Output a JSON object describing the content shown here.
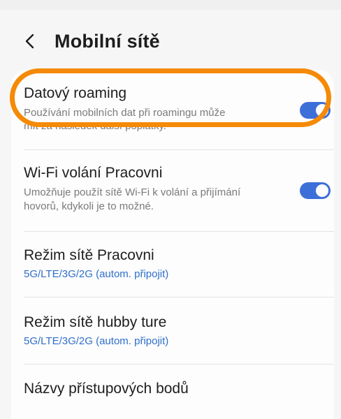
{
  "header": {
    "title": "Mobilní sítě"
  },
  "items": [
    {
      "title": "Datový roaming",
      "description_line1": "Používání mobilních dat při roamingu může",
      "description_line2": "mít za následek další poplatky.",
      "toggle_on": true
    },
    {
      "title": "Wi-Fi volání Pracovni",
      "description": "Umožňuje použít sítě Wi-Fi k volání a přijímání hovorů, kdykoli je to možné.",
      "toggle_on": true
    },
    {
      "title": "Režim sítě Pracovni",
      "value": "5G/LTE/3G/2G (autom. připojit)"
    },
    {
      "title": "Režim sítě hubby ture",
      "value": "5G/LTE/3G/2G (autom. připojit)"
    },
    {
      "title": "Názvy přístupových bodů"
    }
  ],
  "colors": {
    "accent": "#3d6fd8",
    "link": "#2f6fc9",
    "highlight": "#f58a07"
  },
  "icons": {
    "back": "chevron-left-icon"
  }
}
